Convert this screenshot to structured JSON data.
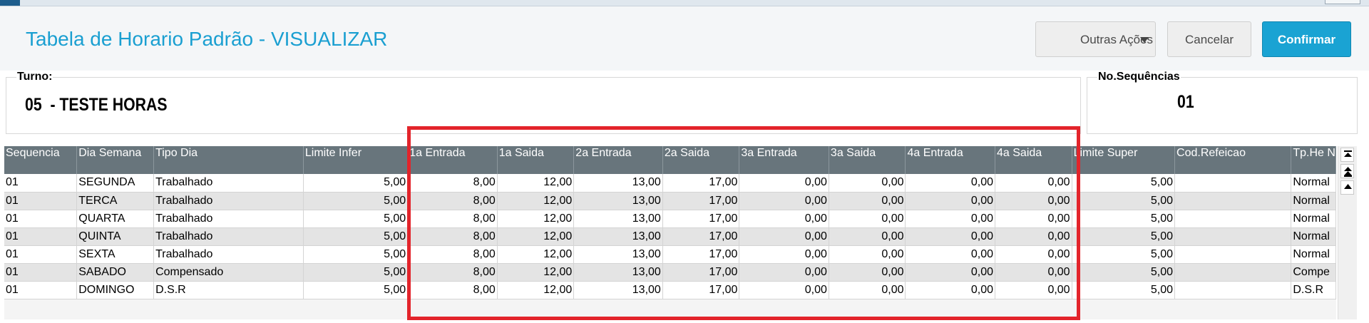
{
  "page": {
    "title": "Tabela de Horario Padrão - VISUALIZAR"
  },
  "actions": {
    "outras_acoes": "Outras Ações",
    "cancelar": "Cancelar",
    "confirmar": "Confirmar"
  },
  "turno": {
    "label": "Turno:",
    "value": "05  - TESTE HORAS"
  },
  "sequencias": {
    "label": "No.Sequências",
    "value": "01"
  },
  "grid": {
    "columns": [
      "Sequencia",
      "Dia Semana",
      "Tipo Dia",
      "Limite Infer",
      "1a Entrada",
      "1a Saida",
      "2a Entrada",
      "2a Saida",
      "3a Entrada",
      "3a Saida",
      "4a Entrada",
      "4a Saida",
      "Limite Super",
      "Cod.Refeicao",
      "Tp.He N"
    ],
    "rows": [
      [
        "01",
        "SEGUNDA",
        "Trabalhado",
        "5,00",
        "8,00",
        "12,00",
        "13,00",
        "17,00",
        "0,00",
        "0,00",
        "0,00",
        "0,00",
        "5,00",
        "",
        "Normal"
      ],
      [
        "01",
        "TERCA",
        "Trabalhado",
        "5,00",
        "8,00",
        "12,00",
        "13,00",
        "17,00",
        "0,00",
        "0,00",
        "0,00",
        "0,00",
        "5,00",
        "",
        "Normal"
      ],
      [
        "01",
        "QUARTA",
        "Trabalhado",
        "5,00",
        "8,00",
        "12,00",
        "13,00",
        "17,00",
        "0,00",
        "0,00",
        "0,00",
        "0,00",
        "5,00",
        "",
        "Normal"
      ],
      [
        "01",
        "QUINTA",
        "Trabalhado",
        "5,00",
        "8,00",
        "12,00",
        "13,00",
        "17,00",
        "0,00",
        "0,00",
        "0,00",
        "0,00",
        "5,00",
        "",
        "Normal"
      ],
      [
        "01",
        "SEXTA",
        "Trabalhado",
        "5,00",
        "8,00",
        "12,00",
        "13,00",
        "17,00",
        "0,00",
        "0,00",
        "0,00",
        "0,00",
        "5,00",
        "",
        "Normal"
      ],
      [
        "01",
        "SABADO",
        "Compensado",
        "5,00",
        "8,00",
        "12,00",
        "13,00",
        "17,00",
        "0,00",
        "0,00",
        "0,00",
        "0,00",
        "5,00",
        "",
        "Compe"
      ],
      [
        "01",
        "DOMINGO",
        "D.S.R",
        "5,00",
        "8,00",
        "12,00",
        "13,00",
        "17,00",
        "0,00",
        "0,00",
        "0,00",
        "0,00",
        "5,00",
        "",
        "D.S.R"
      ]
    ]
  },
  "scroll_icons": [
    "scroll-top-icon",
    "scroll-page-up-icon",
    "scroll-up-icon"
  ],
  "colors": {
    "accent": "#1aa3d3",
    "title": "#1a9fd1",
    "grid_header": "#68757c",
    "highlight": "#e3242b"
  }
}
